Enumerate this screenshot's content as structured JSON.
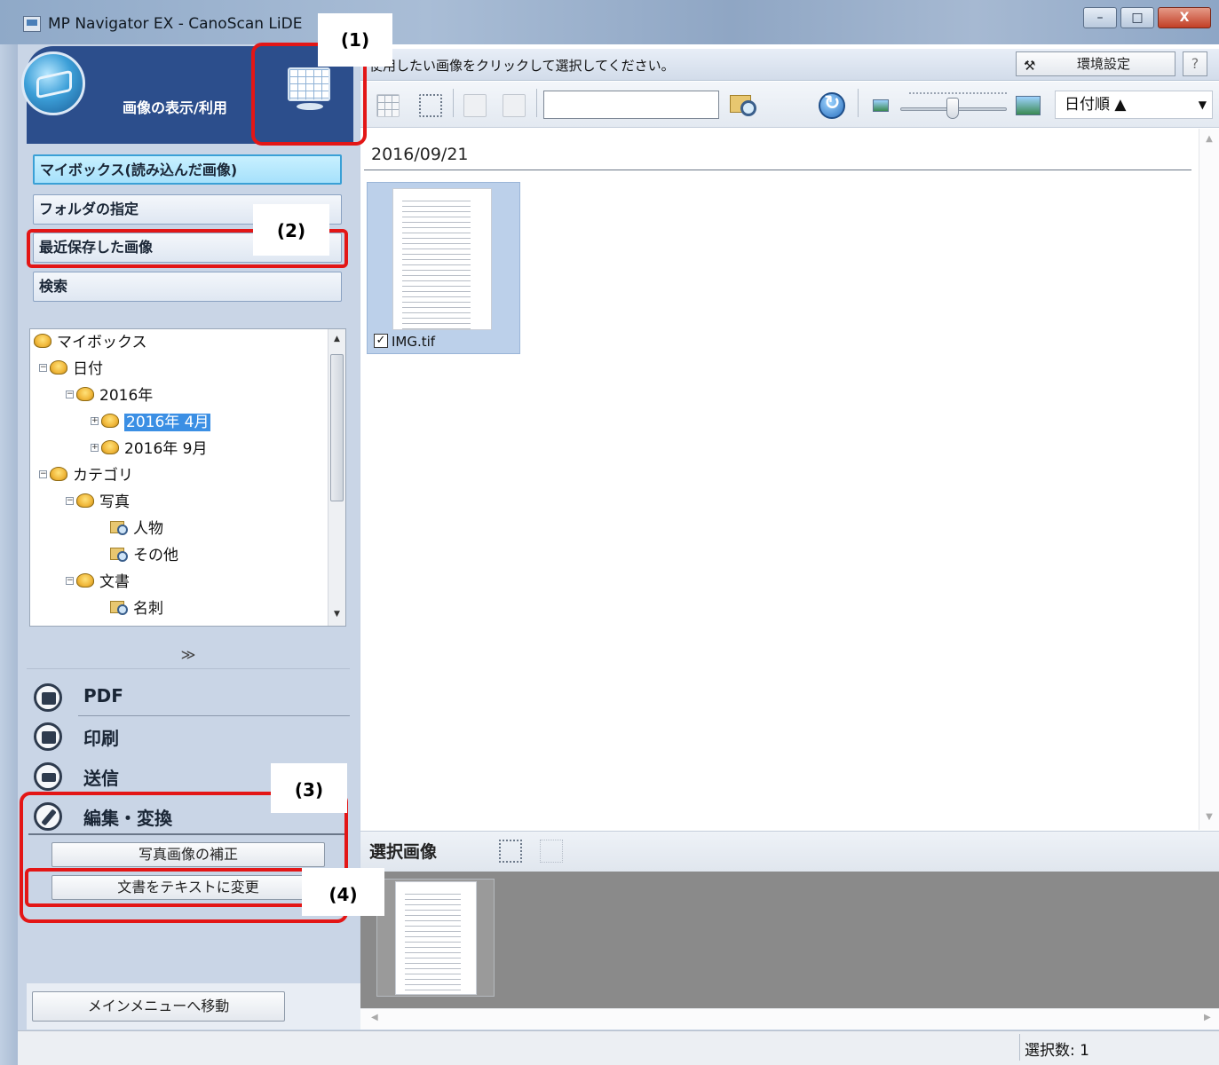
{
  "window": {
    "title": "MP Navigator EX - CanoScan LiDE",
    "controls": [
      "–",
      "□",
      "X"
    ]
  },
  "left": {
    "header_title": "画像の表示/利用",
    "nav": [
      "マイボックス(読み込んだ画像)",
      "フォルダの指定",
      "最近保存した画像",
      "検索"
    ],
    "tree": [
      "マイボックス",
      "日付",
      "2016年",
      "2016年 4月",
      "2016年 9月",
      "カテゴリ",
      "写真",
      "人物",
      "その他",
      "文書",
      "名刺"
    ],
    "chevron": "≫",
    "actions": [
      "PDF",
      "印刷",
      "送信",
      "編集・変換"
    ],
    "edit_buttons": [
      "写真画像の補正",
      "文書をテキストに変更"
    ],
    "main_menu_button": "メインメニューへ移動"
  },
  "main": {
    "instruction": "使用したい画像をクリックして選択してください。",
    "env_settings": "環境設定",
    "help": "?",
    "sort": {
      "label": "日付順",
      "indicator": "▲"
    },
    "date_group": "2016/09/21",
    "thumbnails": [
      {
        "name": "IMG.tif",
        "checked": true
      }
    ],
    "selection_title": "選択画像",
    "status": "選択数: 1"
  },
  "annotations": {
    "labels": [
      "(1)",
      "(2)",
      "(3)",
      "(4)"
    ],
    "color": "#e31616"
  },
  "icons": {
    "app": "scanner-app-icon",
    "header": "globe-icon",
    "view": "monitor-grid-icon",
    "env": "tools-icon",
    "search": "folder-search-icon",
    "refresh": "refresh-icon"
  }
}
